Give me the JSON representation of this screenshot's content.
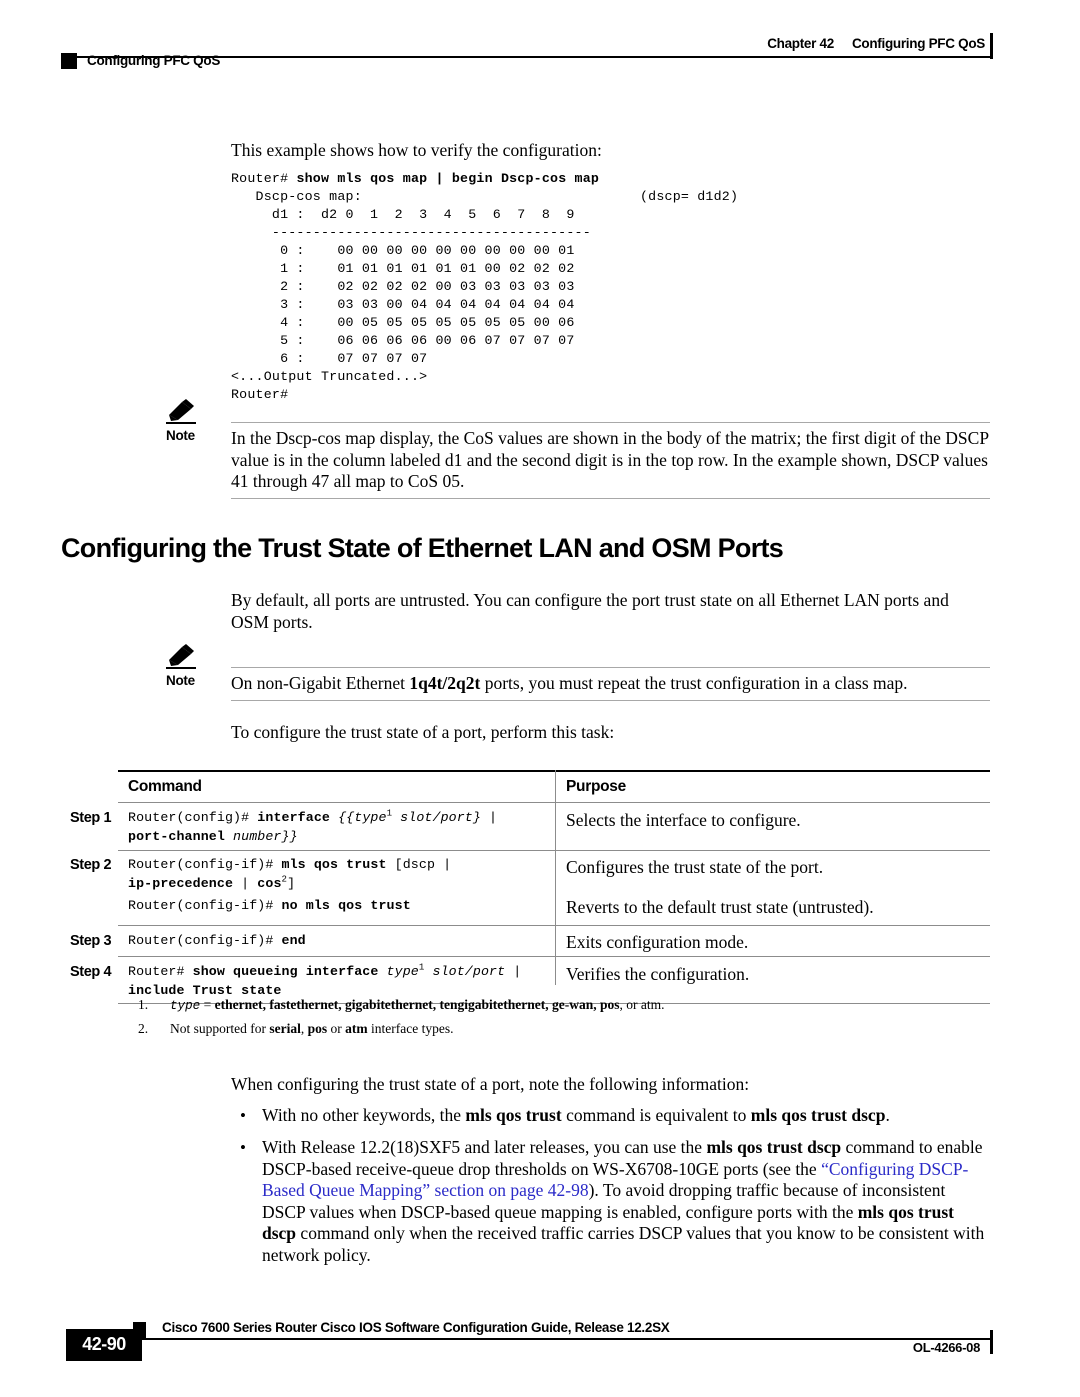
{
  "header": {
    "chapter": "Chapter 42",
    "chapter_title": "Configuring PFC QoS",
    "left_title": "Configuring PFC QoS"
  },
  "intro": {
    "example_lead": "This example shows how to verify the configuration:"
  },
  "code_block": {
    "prompt": "Router#",
    "command": "show mls qos map | begin Dscp-cos map",
    "lines": [
      "   Dscp-cos map:                                  (dscp= d1d2)",
      "     d1 :  d2 0  1  2  3  4  5  6  7  8  9",
      "     ---------------------------------------",
      "      0 :    00 00 00 00 00 00 00 00 00 01",
      "      1 :    01 01 01 01 01 01 00 02 02 02",
      "      2 :    02 02 02 02 00 03 03 03 03 03",
      "      3 :    03 03 00 04 04 04 04 04 04 04",
      "      4 :    00 05 05 05 05 05 05 05 00 06",
      "      5 :    06 06 06 06 00 06 07 07 07 07",
      "      6 :    07 07 07 07",
      "<...Output Truncated...>",
      "Router#"
    ]
  },
  "note1": {
    "label": "Note",
    "text": "In the Dscp-cos map display, the CoS values are shown in the body of the matrix; the first digit of the DSCP value is in the column labeled d1 and the second digit is in the top row. In the example shown, DSCP values 41 through 47 all map to CoS 05."
  },
  "section": {
    "heading": "Configuring the Trust State of Ethernet LAN and OSM Ports",
    "intro": "By default, all ports are untrusted. You can configure the port trust state on all Ethernet LAN ports and OSM ports.",
    "task_lead": "To configure the trust state of a port, perform this task:"
  },
  "note2": {
    "label": "Note",
    "text_pre": "On non-Gigabit Ethernet ",
    "text_bold": "1q4t/2q2t",
    "text_post": " ports, you must repeat the trust configuration in a class map."
  },
  "table": {
    "col_command": "Command",
    "col_purpose": "Purpose",
    "rows": [
      {
        "step": "Step 1",
        "command_line1_prompt": "Router(config)# ",
        "command_line1_bold": "interface",
        "command_line1_rest": " {{type",
        "command_line1_sup": "1",
        "command_line1_tail": " slot/port} |",
        "command_line2_bold": "port-channel",
        "command_line2_rest": " number}}",
        "purpose": "Selects the interface to configure."
      },
      {
        "step": "Step 2",
        "command_line1_prompt": "Router(config-if)# ",
        "command_line1_bold": "mls qos trust",
        "command_line1_rest": " [dscp |",
        "command_line2_bold": "ip-precedence",
        "command_line2_mid": " | ",
        "command_line2_bold2": "cos",
        "command_line2_sup": "2",
        "command_line2_tail": "]",
        "purpose": "Configures the trust state of the port.",
        "sub_prompt": "Router(config-if)# ",
        "sub_bold": "no mls qos trust",
        "sub_purpose": "Reverts to the default trust state (untrusted)."
      },
      {
        "step": "Step 3",
        "command_line1_prompt": "Router(config-if)# ",
        "command_line1_bold": "end",
        "purpose": "Exits configuration mode."
      },
      {
        "step": "Step 4",
        "command_line1_prompt": "Router# ",
        "command_line1_bold": "show queueing interface",
        "command_line1_rest": " type",
        "command_line1_sup": "1",
        "command_line1_tail": " slot/port |",
        "command_line2_bold": "include Trust state",
        "purpose": "Verifies the configuration."
      }
    ]
  },
  "footnotes": [
    {
      "num": "1.",
      "pre": "type",
      "eq": " = ",
      "bold_list": "ethernet, fastethernet, gigabitethernet, tengigabitethernet, ge-wan, pos",
      "post": ", or atm."
    },
    {
      "num": "2.",
      "text_pre": "Not supported for ",
      "b1": "serial",
      "t1": ", ",
      "b2": "pos",
      "t2": " or ",
      "b3": "atm",
      "t3": " interface types."
    }
  ],
  "notes_section": {
    "lead": "When configuring the trust state of a port, note the following information:",
    "bullet_char": "•",
    "bullets": [
      {
        "p1": "With no other keywords, the ",
        "b1": "mls qos trust",
        "p2": " command is equivalent to ",
        "b2": "mls qos trust dscp",
        "p3": "."
      },
      {
        "p1": "With Release 12.2(18)SXF5 and later releases, you can use the ",
        "b1": "mls qos trust dscp",
        "p2": " command to enable DSCP-based receive-queue drop thresholds on WS-X6708-10GE ports (see the ",
        "link": "“Configuring DSCP-Based Queue Mapping” section on page 42-98",
        "p3": "). To avoid dropping traffic because of inconsistent DSCP values when DSCP-based queue mapping is enabled, configure ports with the ",
        "b2": "mls qos trust dscp",
        "p4": " command only when the received traffic carries DSCP values that you know to be consistent with network policy."
      }
    ]
  },
  "footer": {
    "guide_title": "Cisco 7600 Series Router Cisco IOS Software Configuration Guide, Release 12.2SX",
    "page_number": "42-90",
    "doc_number": "OL-4266-08"
  },
  "colors": {
    "link": "#2b2bc8",
    "rule_heavy": "#000000",
    "rule_light": "#8c8c8c"
  }
}
